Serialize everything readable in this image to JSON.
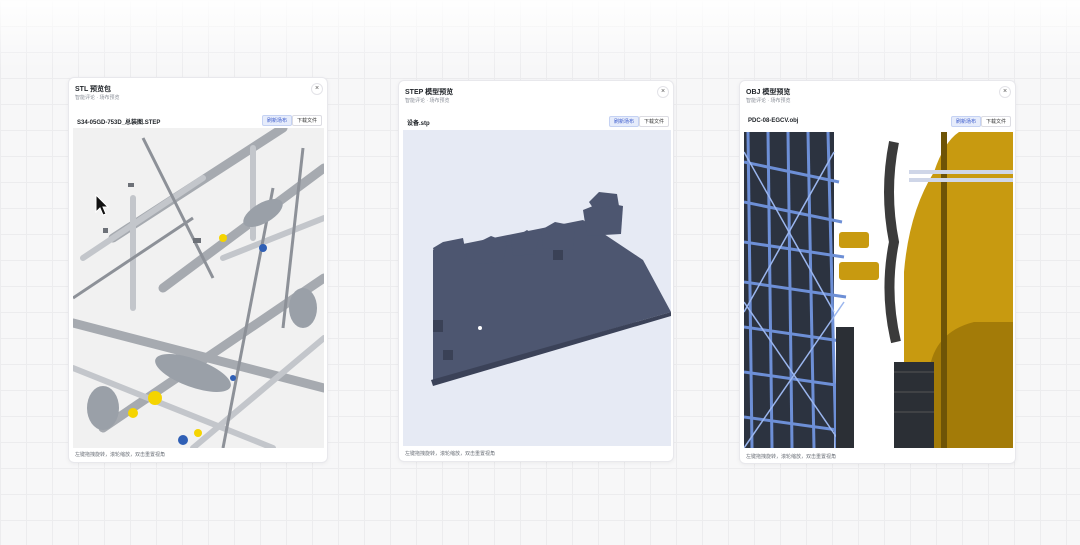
{
  "cards": [
    {
      "title": "STL 预览包",
      "subtitle": "智能评论 · 场布预览",
      "close_label": "×",
      "file_name": "S34-05GD-753D_总装图.STEP",
      "primary_btn": "刷新场布",
      "download_btn": "下载文件",
      "hint": "左键拖拽旋转，滚轮缩放，双击重置视角",
      "model_color": "#d9dadc"
    },
    {
      "title": "STEP 模型预览",
      "subtitle": "智能评论 · 场布预览",
      "close_label": "×",
      "file_name": "设备.stp",
      "primary_btn": "刷新场布",
      "download_btn": "下载文件",
      "hint": "左键拖拽旋转，滚轮缩放，双击重置视角",
      "model_color": "#4d5670"
    },
    {
      "title": "OBJ 模型预览",
      "subtitle": "智能评论 · 场布预览",
      "close_label": "×",
      "file_name": "PDC-08-EGCV.obj",
      "primary_btn": "刷新场布",
      "download_btn": "下载文件",
      "hint": "左键拖拽旋转，滚轮缩放，双击重置视角",
      "model_color": "#c89a10"
    }
  ],
  "icons": {
    "close": "close-icon",
    "cursor": "mouse-pointer-icon"
  }
}
